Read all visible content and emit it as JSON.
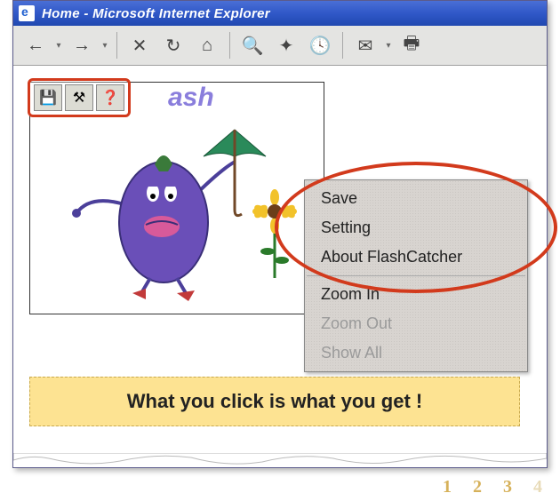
{
  "window": {
    "title": "Home - Microsoft Internet Explorer"
  },
  "toolbar_icons": {
    "back": "←",
    "forward": "→",
    "stop": "✕",
    "refresh": "↻",
    "home": "⌂",
    "search": "🔍",
    "favorites": "✦",
    "history": "🕓",
    "mail": "✉",
    "print": "🖶"
  },
  "flash": {
    "title_text": "ash"
  },
  "mini_toolbar": {
    "save_icon": "💾",
    "tool_icon": "⚒",
    "help_icon": "❓"
  },
  "context_menu": {
    "items": [
      {
        "label": "Save",
        "enabled": true
      },
      {
        "label": "Setting",
        "enabled": true
      },
      {
        "label": "About FlashCatcher",
        "enabled": true
      },
      {
        "label": "Zoom In",
        "enabled": true
      },
      {
        "label": "Zoom Out",
        "enabled": false
      },
      {
        "label": "Show All",
        "enabled": false
      }
    ]
  },
  "banner": {
    "text": "What you click is what you get !"
  },
  "pager": {
    "pages": [
      "1",
      "2",
      "3",
      "4"
    ]
  }
}
